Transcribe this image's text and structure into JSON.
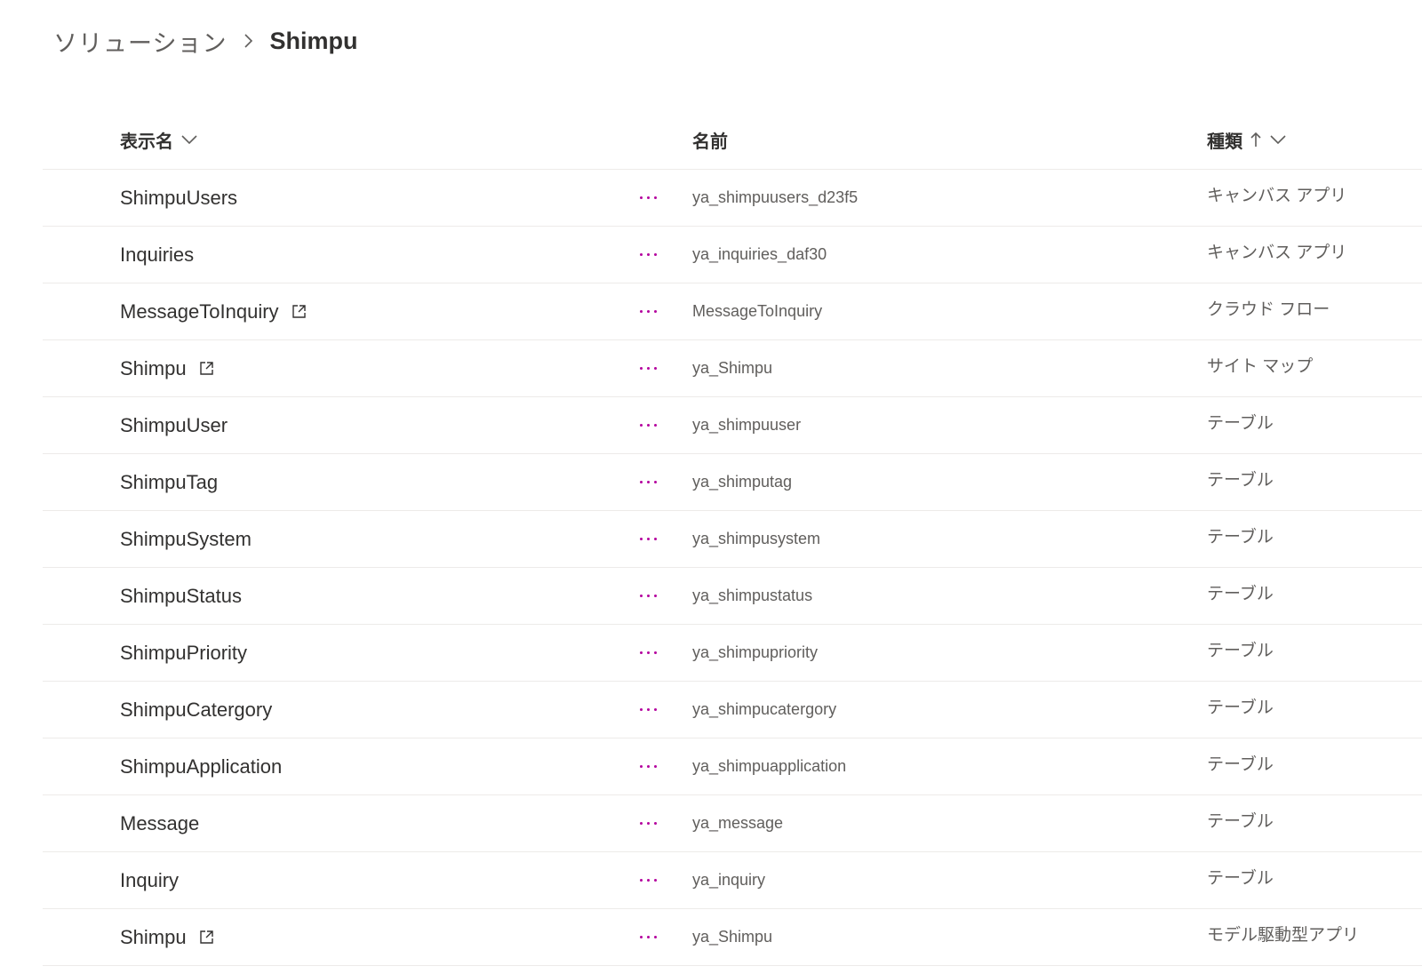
{
  "breadcrumb": {
    "parent": "ソリューション",
    "current": "Shimpu"
  },
  "columns": {
    "display_name": "表示名",
    "name": "名前",
    "type": "種類"
  },
  "icons": {
    "sort_menu": "chevron-down-icon",
    "sort_ascending": "arrow-up-icon",
    "external_link": "open-in-new-icon",
    "more": "more-options-icon",
    "breadcrumb_separator": "chevron-right-icon"
  },
  "colors": {
    "accent_dots": "#b4009e"
  },
  "rows": [
    {
      "display_name": "ShimpuUsers",
      "external": false,
      "name": "ya_shimpuusers_d23f5",
      "type": "キャンバス アプリ"
    },
    {
      "display_name": "Inquiries",
      "external": false,
      "name": "ya_inquiries_daf30",
      "type": "キャンバス アプリ"
    },
    {
      "display_name": "MessageToInquiry",
      "external": true,
      "name": "MessageToInquiry",
      "type": "クラウド フロー"
    },
    {
      "display_name": "Shimpu",
      "external": true,
      "name": "ya_Shimpu",
      "type": "サイト マップ"
    },
    {
      "display_name": "ShimpuUser",
      "external": false,
      "name": "ya_shimpuuser",
      "type": "テーブル"
    },
    {
      "display_name": "ShimpuTag",
      "external": false,
      "name": "ya_shimputag",
      "type": "テーブル"
    },
    {
      "display_name": "ShimpuSystem",
      "external": false,
      "name": "ya_shimpusystem",
      "type": "テーブル"
    },
    {
      "display_name": "ShimpuStatus",
      "external": false,
      "name": "ya_shimpustatus",
      "type": "テーブル"
    },
    {
      "display_name": "ShimpuPriority",
      "external": false,
      "name": "ya_shimpupriority",
      "type": "テーブル"
    },
    {
      "display_name": "ShimpuCatergory",
      "external": false,
      "name": "ya_shimpucatergory",
      "type": "テーブル"
    },
    {
      "display_name": "ShimpuApplication",
      "external": false,
      "name": "ya_shimpuapplication",
      "type": "テーブル"
    },
    {
      "display_name": "Message",
      "external": false,
      "name": "ya_message",
      "type": "テーブル"
    },
    {
      "display_name": "Inquiry",
      "external": false,
      "name": "ya_inquiry",
      "type": "テーブル"
    },
    {
      "display_name": "Shimpu",
      "external": true,
      "name": "ya_Shimpu",
      "type": "モデル駆動型アプリ"
    }
  ]
}
